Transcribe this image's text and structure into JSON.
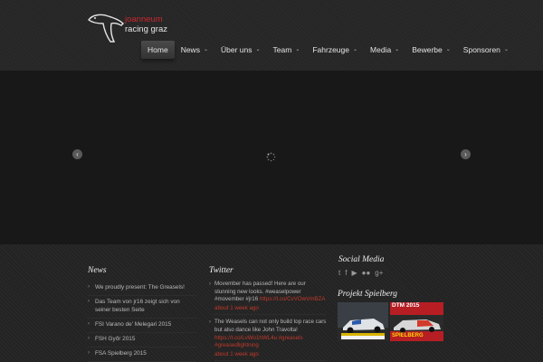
{
  "logo": {
    "line1": "joanneum",
    "line2": "racing graz"
  },
  "nav": [
    {
      "label": "Home",
      "caret": ""
    },
    {
      "label": "News",
      "caret": "⌄"
    },
    {
      "label": "Über uns",
      "caret": "⌄"
    },
    {
      "label": "Team",
      "caret": "⌄"
    },
    {
      "label": "Fahrzeuge",
      "caret": "⌄"
    },
    {
      "label": "Media",
      "caret": "⌄"
    },
    {
      "label": "Bewerbe",
      "caret": "⌄"
    },
    {
      "label": "Sponsoren",
      "caret": "⌄"
    }
  ],
  "slider": {
    "prev": "‹",
    "next": "›"
  },
  "news": {
    "title": "News",
    "items": [
      "We proudly present: The Greasels!",
      "Das Team von jr16 zeigt sich von seiner besten Seite",
      "FSI Varano de' Melegari 2015",
      "FSH Győr 2015",
      "FSA Spielberg 2015"
    ]
  },
  "twitter": {
    "title": "Twitter",
    "tweets": [
      {
        "text": "Movember has passed! Here are our stunning new looks. #weaselpower #movember #jr16",
        "link": "https://t.co/CvVOwVmBZA",
        "time": "about 1 week ago"
      },
      {
        "text": "The Weasels can not only build top race cars but also dance like John Travolta!",
        "link": "https://t.co/LvWo1hWL4u #greasels #greasedlightning",
        "time": "about 1 week ago"
      }
    ]
  },
  "social": {
    "title": "Social Media",
    "icons": [
      "twitter-icon",
      "facebook-icon",
      "youtube-icon",
      "flickr-icon",
      "google-plus-icon"
    ],
    "glyphs": [
      "t",
      "f",
      "▶",
      "●●",
      "g+"
    ]
  },
  "project": {
    "title": "Projekt Spielberg",
    "ad2_line1": "DTM 2015",
    "ad2_line2": "SPIELBERG"
  },
  "colors": {
    "accent": "#c0392b",
    "background": "#1f1f1f"
  }
}
